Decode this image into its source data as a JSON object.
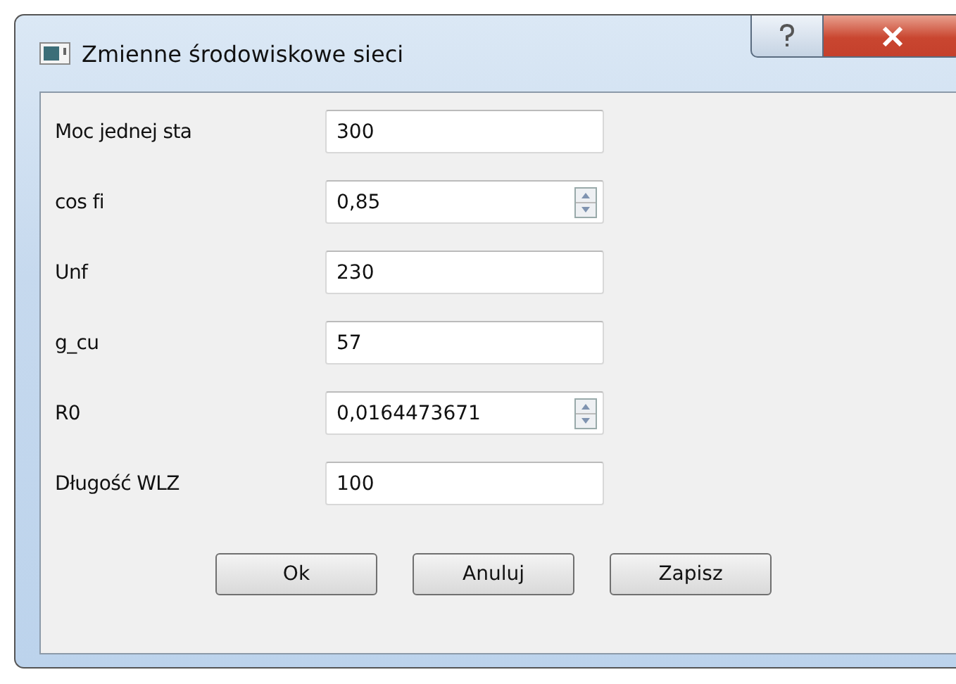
{
  "window": {
    "title": "Zmienne środowiskowe sieci"
  },
  "fields": [
    {
      "label": "Moc jednej sta",
      "value": "300",
      "kind": "text"
    },
    {
      "label": "cos fi",
      "value": "0,85",
      "kind": "spin"
    },
    {
      "label": "Unf",
      "value": "230",
      "kind": "text"
    },
    {
      "label": "g_cu",
      "value": "57",
      "kind": "text"
    },
    {
      "label": "R0",
      "value": "0,0164473671",
      "kind": "spin"
    },
    {
      "label": "Długość WLZ",
      "value": "100",
      "kind": "text"
    }
  ],
  "buttons": [
    "Ok",
    "Anuluj",
    "Zapisz"
  ]
}
